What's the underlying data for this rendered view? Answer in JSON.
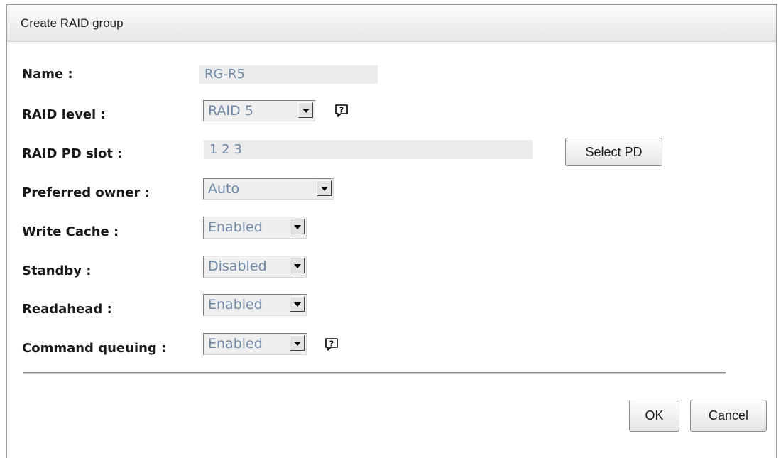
{
  "dialog": {
    "title": "Create RAID group"
  },
  "form": {
    "name": {
      "label": "Name :",
      "value": "RG-R5"
    },
    "raid_level": {
      "label": "RAID level :",
      "value": "RAID 5"
    },
    "raid_pd_slot": {
      "label": "RAID PD slot :",
      "value": "1 2 3"
    },
    "preferred_owner": {
      "label": "Preferred owner :",
      "value": "Auto"
    },
    "write_cache": {
      "label": "Write Cache :",
      "value": "Enabled"
    },
    "standby": {
      "label": "Standby :",
      "value": "Disabled"
    },
    "readahead": {
      "label": "Readahead :",
      "value": "Enabled"
    },
    "command_queuing": {
      "label": "Command queuing :",
      "value": "Enabled"
    }
  },
  "buttons": {
    "select_pd": "Select PD",
    "ok": "OK",
    "cancel": "Cancel"
  },
  "icons": {
    "help": "help-icon"
  }
}
